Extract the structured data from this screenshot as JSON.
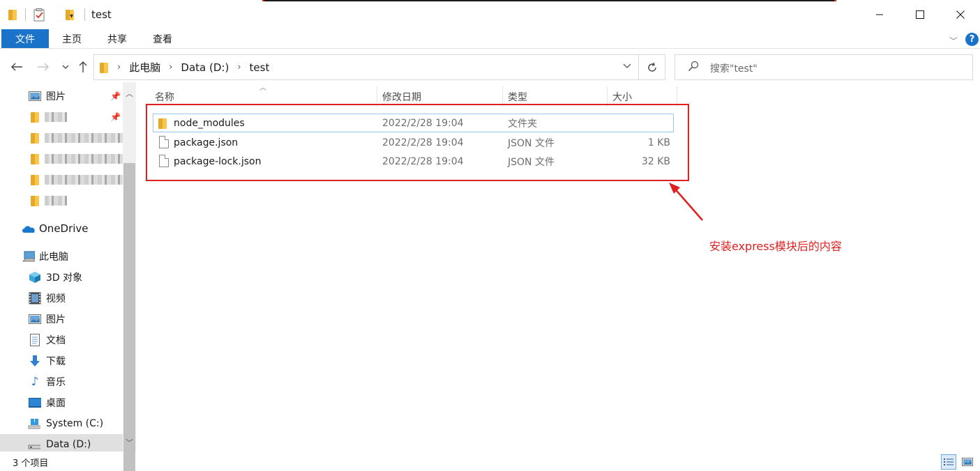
{
  "window": {
    "title": "test",
    "minimize_icon": "minimize-icon",
    "maximize_icon": "maximize-icon",
    "close_icon": "close-icon"
  },
  "ribbon": {
    "tabs": [
      {
        "label": "文件",
        "active": true
      },
      {
        "label": "主页"
      },
      {
        "label": "共享"
      },
      {
        "label": "查看"
      }
    ],
    "help_label": "?"
  },
  "address": {
    "crumbs": [
      "此电脑",
      "Data (D:)",
      "test"
    ]
  },
  "search": {
    "placeholder": "搜索\"test\""
  },
  "nav": {
    "quick_access": [
      {
        "label": "图片",
        "icon": "pictures-icon",
        "pinned": true
      },
      {
        "label": "",
        "icon": "folder-icon",
        "pinned": true,
        "blurred": true
      },
      {
        "label": "",
        "icon": "folder-icon",
        "blurred": true
      },
      {
        "label": "",
        "icon": "folder-icon",
        "blurred": true
      },
      {
        "label": "",
        "icon": "folder-icon",
        "blurred": true
      },
      {
        "label": "",
        "icon": "folder-icon",
        "blurred": true
      }
    ],
    "onedrive": "OneDrive",
    "this_pc": "此电脑",
    "pc_items": [
      {
        "label": "3D 对象",
        "icon": "3d-objects-icon"
      },
      {
        "label": "视频",
        "icon": "videos-icon"
      },
      {
        "label": "图片",
        "icon": "pictures-icon"
      },
      {
        "label": "文档",
        "icon": "documents-icon"
      },
      {
        "label": "下载",
        "icon": "downloads-icon"
      },
      {
        "label": "音乐",
        "icon": "music-icon"
      },
      {
        "label": "桌面",
        "icon": "desktop-icon"
      },
      {
        "label": "System (C:)",
        "icon": "drive-icon"
      },
      {
        "label": "Data (D:)",
        "icon": "drive-icon",
        "selected": true
      }
    ]
  },
  "columns": {
    "name": "名称",
    "date": "修改日期",
    "type": "类型",
    "size": "大小"
  },
  "files": [
    {
      "name": "node_modules",
      "date": "2022/2/28 19:04",
      "type": "文件夹",
      "size": "",
      "icon": "folder-icon"
    },
    {
      "name": "package.json",
      "date": "2022/2/28 19:04",
      "type": "JSON 文件",
      "size": "1 KB",
      "icon": "file-icon"
    },
    {
      "name": "package-lock.json",
      "date": "2022/2/28 19:04",
      "type": "JSON 文件",
      "size": "32 KB",
      "icon": "file-icon"
    }
  ],
  "annotation": {
    "text": "安装express模块后的内容",
    "color": "#e02020"
  },
  "status": {
    "item_count": "3 个项目"
  },
  "colors": {
    "accent": "#1a73c8",
    "selection_border": "#99c9ef"
  }
}
